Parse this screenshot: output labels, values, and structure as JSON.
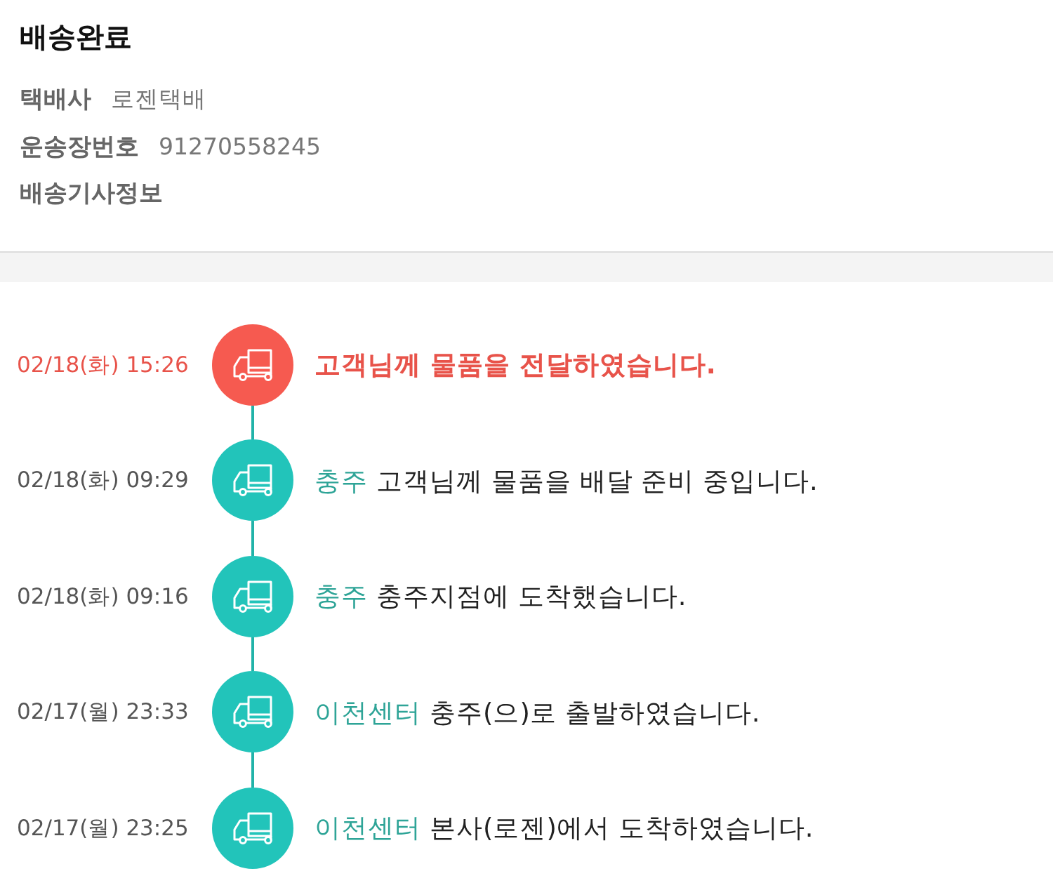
{
  "status": {
    "title": "배송완료"
  },
  "info": [
    {
      "label": "택배사",
      "value": "로젠택배"
    },
    {
      "label": "운송장번호",
      "value": "91270558245"
    },
    {
      "label": "배송기사정보"
    }
  ],
  "events": [
    {
      "time": "02/18(화) 15:26",
      "message": "고객님께 물품을 전달하였습니다.",
      "current": true
    },
    {
      "time": "02/18(화) 09:29",
      "location": "충주",
      "message": "고객님께 물품을 배달 준비 중입니다.",
      "current": false
    },
    {
      "time": "02/18(화) 09:16",
      "location": "충주",
      "message": "충주지점에 도착했습니다.",
      "current": false
    },
    {
      "time": "02/17(월) 23:33",
      "location": "이천센터",
      "message": "충주(으)로 출발하였습니다.",
      "current": false
    },
    {
      "time": "02/17(월) 23:25",
      "location": "이천센터",
      "message": "본사(로젠)에서 도착하였습니다.",
      "current": false
    }
  ]
}
